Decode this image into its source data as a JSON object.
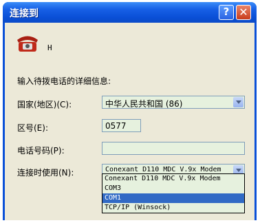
{
  "window": {
    "title": "连接到",
    "help_glyph": "?",
    "close_glyph": "✕"
  },
  "connection": {
    "icon": "phone-icon",
    "name": "H"
  },
  "prompt": "输入待拨电话的详细信息:",
  "fields": {
    "country_label": "国家(地区)(C):",
    "country_value": "中华人民共和国 (86)",
    "area_label": "区号(E):",
    "area_value": "0577",
    "phone_label": "电话号码(P):",
    "phone_value": "",
    "connect_label": "连接时使用(N):",
    "connect_value": "Conexant D110 MDC V.9x Modem"
  },
  "dropdown": {
    "options": [
      "Conexant D110 MDC V.9x Modem",
      "COM3",
      "COM1",
      "TCP/IP (Winsock)"
    ],
    "highlighted": "COM1"
  },
  "colors": {
    "titlebar": "#0a4fd6",
    "field_bg": "#e6f1de",
    "selection": "#316ac5",
    "close_button": "#c93c1b"
  }
}
